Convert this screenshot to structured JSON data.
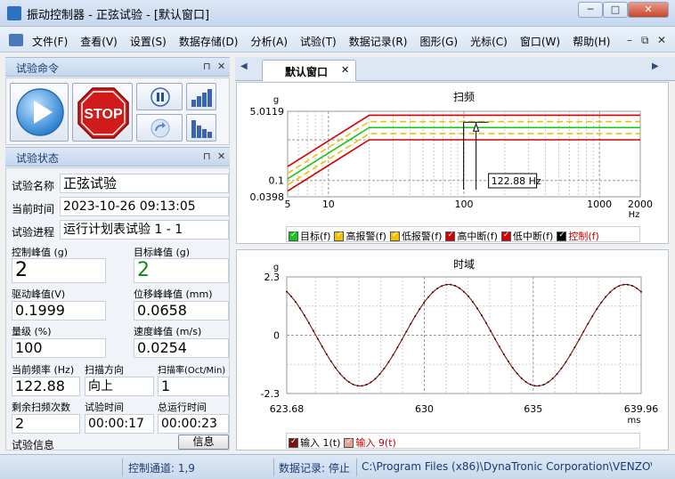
{
  "window": {
    "title": "振动控制器 - 正弦试验 - [默认窗口]",
    "min": "─",
    "max": "□",
    "close": "✕"
  },
  "menu": {
    "items": [
      "文件(F)",
      "查看(V)",
      "设置(S)",
      "数据存储(D)",
      "分析(A)",
      "试验(T)",
      "数据记录(R)",
      "图形(G)",
      "光标(C)",
      "窗口(W)",
      "帮助(H)"
    ],
    "mdi_min": "–",
    "mdi_restore": "⧉",
    "mdi_close": "✕"
  },
  "test_command": {
    "title": "试验命令",
    "pin": "⊓",
    "close": "✕",
    "stop_label": "STOP"
  },
  "test_status": {
    "title": "试验状态",
    "pin": "⊓",
    "close": "✕",
    "name_label": "试验名称",
    "name_value": "正弦试验",
    "time_label": "当前时间",
    "time_value": "2023-10-26 09:13:05",
    "progress_label": "试验进程",
    "progress_value": "运行计划表试验 1 - 1",
    "control_peak_label": "控制峰值 (g)",
    "control_peak_value": "2",
    "target_peak_label": "目标峰值 (g)",
    "target_peak_value": "2",
    "drive_peak_label": "驱动峰值(V)",
    "drive_peak_value": "0.1999",
    "disp_peak_label": "位移峰峰值 (mm)",
    "disp_peak_value": "0.0658",
    "level_label": "量级 (%)",
    "level_value": "100",
    "vel_peak_label": "速度峰值 (m/s)",
    "vel_peak_value": "0.0254",
    "freq_label": "当前频率 (Hz)",
    "freq_value": "122.88",
    "dir_label": "扫描方向",
    "dir_value": "向上",
    "rate_label": "扫描率(Oct/Min)",
    "rate_value": "1",
    "remain_label": "剩余扫频次数",
    "remain_value": "2",
    "testtime_label": "试验时间",
    "testtime_value": "00:00:17",
    "runtime_label": "总运行时间",
    "runtime_value": "00:00:23",
    "info_label": "试验信息",
    "info_button": "信息"
  },
  "tabs": {
    "active": "默认窗口",
    "close": "✕",
    "left": "◀",
    "right": "▶"
  },
  "chart_data": [
    {
      "type": "line",
      "title": "扫频",
      "ylabel": "g",
      "xlabel": "Hz",
      "xscale": "log",
      "yscale": "log",
      "xlim": [
        5,
        2000
      ],
      "ylim": [
        0.0398,
        5.0119
      ],
      "x_ticks": [
        "5",
        "10",
        "100",
        "1000",
        "2000"
      ],
      "y_ticks": [
        "5.0119",
        "0.1",
        "0.0398"
      ],
      "cursor_label": "122.88 Hz",
      "cursor_x": 122.88,
      "knee_x": 20,
      "series": [
        {
          "name": "目标(f)",
          "color": "#19c419",
          "style": "solid",
          "flat": 2.0,
          "start": 0.11
        },
        {
          "name": "高报警(f)",
          "color": "#f2c200",
          "style": "dashed",
          "flat": 2.8,
          "start": 0.15
        },
        {
          "name": "低报警(f)",
          "color": "#f2c200",
          "style": "dashed",
          "flat": 1.42,
          "start": 0.078
        },
        {
          "name": "高中断(f)",
          "color": "#d40000",
          "style": "solid",
          "flat": 4.0,
          "start": 0.22
        },
        {
          "name": "低中断(f)",
          "color": "#d40000",
          "style": "solid",
          "flat": 1.0,
          "start": 0.055
        },
        {
          "name": "控制(f)",
          "color": "#000000",
          "style": "solid",
          "flat": null,
          "start": null
        }
      ]
    },
    {
      "type": "line",
      "title": "时域",
      "ylabel": "g",
      "xlabel": "ms",
      "xlim": [
        623.68,
        639.96
      ],
      "ylim": [
        -2.3,
        2.3
      ],
      "x_ticks": [
        "623.68",
        "630",
        "635",
        "639.96"
      ],
      "y_ticks": [
        "2.3",
        "0",
        "-2.3"
      ],
      "amplitude": 2.0,
      "frequency_hz": 122.88,
      "series": [
        {
          "name": "输入 1(t)",
          "color": "#7a1010"
        },
        {
          "name": "输入 9(t)",
          "color": "#e8a090"
        }
      ]
    }
  ],
  "status": {
    "channel": "控制通道: 1,9",
    "recording": "数据记录: 停止",
    "path": "C:\\Program Files (x86)\\DynaTronic Corporation\\VENZO\\"
  }
}
